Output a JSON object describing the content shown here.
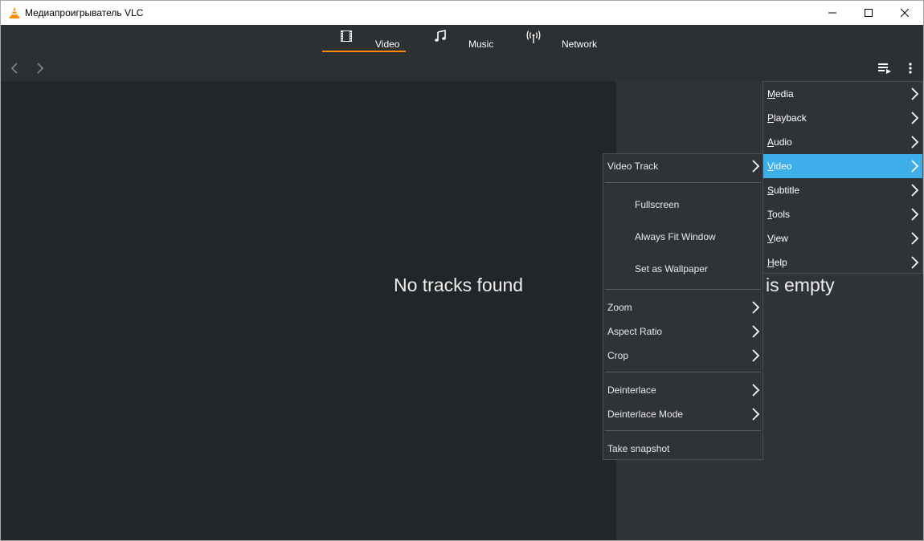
{
  "window": {
    "title": "Медиапроигрыватель VLC",
    "icon": "vlc-cone-icon",
    "controls": [
      "minimize-icon",
      "maximize-icon",
      "close-icon"
    ]
  },
  "tabs": [
    {
      "label": "Video",
      "icon": "film-icon",
      "active": true
    },
    {
      "label": "Music",
      "icon": "music-note-icon",
      "active": false
    },
    {
      "label": "Network",
      "icon": "antenna-icon",
      "active": false
    }
  ],
  "nav": {
    "back_icon": "chevron-left-icon",
    "forward_icon": "chevron-right-icon",
    "playlist_icon": "playlist-icon",
    "more_icon": "more-vertical-icon"
  },
  "content": {
    "empty_message": "No tracks found",
    "playlist_message": "is empty"
  },
  "main_menu": {
    "items": [
      {
        "label": "Media",
        "mnemonic": "M",
        "rest": "edia"
      },
      {
        "label": "Playback",
        "mnemonic": "P",
        "rest": "layback"
      },
      {
        "label": "Audio",
        "mnemonic": "A",
        "rest": "udio"
      },
      {
        "label": "Video",
        "mnemonic": "V",
        "rest": "ideo",
        "active": true
      },
      {
        "label": "Subtitle",
        "mnemonic": "S",
        "rest": "ubtitle"
      },
      {
        "label": "Tools",
        "mnemonic": "T",
        "rest": "ools"
      },
      {
        "label": "View",
        "mnemonic": "V",
        "rest": "iew"
      },
      {
        "label": "Help",
        "mnemonic": "H",
        "rest": "elp"
      }
    ]
  },
  "video_menu": {
    "items": [
      {
        "label": "Video Track",
        "submenu": true
      },
      {
        "label": "Fullscreen",
        "submenu": false
      },
      {
        "label": "Always Fit Window",
        "submenu": false
      },
      {
        "label": "Set as Wallpaper",
        "submenu": false
      },
      {
        "label": "Zoom",
        "submenu": true
      },
      {
        "label": "Aspect Ratio",
        "submenu": true
      },
      {
        "label": "Crop",
        "submenu": true
      },
      {
        "label": "Deinterlace",
        "submenu": true
      },
      {
        "label": "Deinterlace Mode",
        "submenu": true
      },
      {
        "label": "Take snapshot",
        "submenu": false
      }
    ]
  },
  "colors": {
    "accent": "#ff8800",
    "selection": "#3daee9",
    "background": "#232629",
    "panel": "#2f3236"
  }
}
